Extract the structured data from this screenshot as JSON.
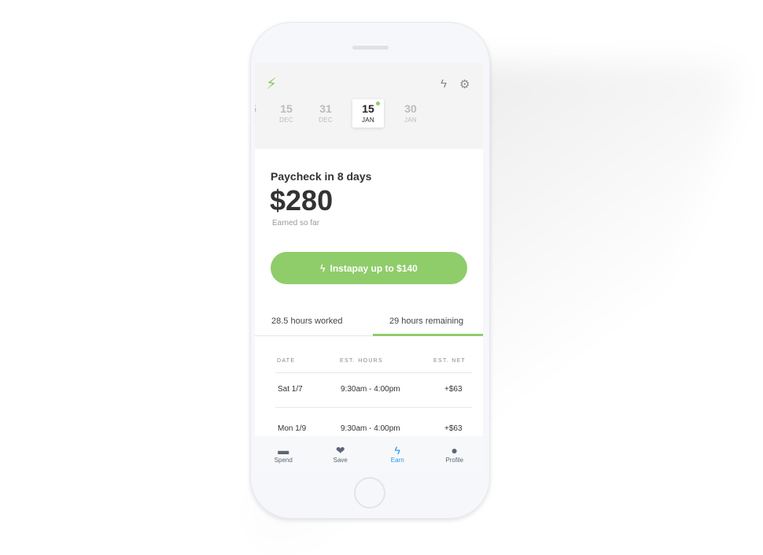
{
  "header": {
    "settings_icon": "gear-icon",
    "instapay_icon": "bolt-outline-icon"
  },
  "dates": [
    {
      "day": "5",
      "month": "C"
    },
    {
      "day": "15",
      "month": "DEC"
    },
    {
      "day": "31",
      "month": "DEC"
    },
    {
      "day": "15",
      "month": "JAN"
    },
    {
      "day": "30",
      "month": "JAN"
    }
  ],
  "paycheck": {
    "title": "Paycheck in 8 days",
    "amount": "$280",
    "subtitle": "Earned so far"
  },
  "instapay_label": "Instapay up to $140",
  "tabs": [
    {
      "label": "28.5 hours worked"
    },
    {
      "label": "29 hours remaining"
    }
  ],
  "table": {
    "headers": [
      "DATE",
      "EST. HOURS",
      "EST. NET"
    ],
    "rows": [
      [
        "Sat 1/7",
        "9:30am - 4:00pm",
        "+$63"
      ],
      [
        "Mon 1/9",
        "9:30am - 4:00pm",
        "+$63"
      ]
    ]
  },
  "nav": [
    {
      "label": "Spend"
    },
    {
      "label": "Save"
    },
    {
      "label": "Earn"
    },
    {
      "label": "Profile"
    }
  ],
  "colors": {
    "accent": "#8fcc6a",
    "nav_active": "#2196f3"
  }
}
